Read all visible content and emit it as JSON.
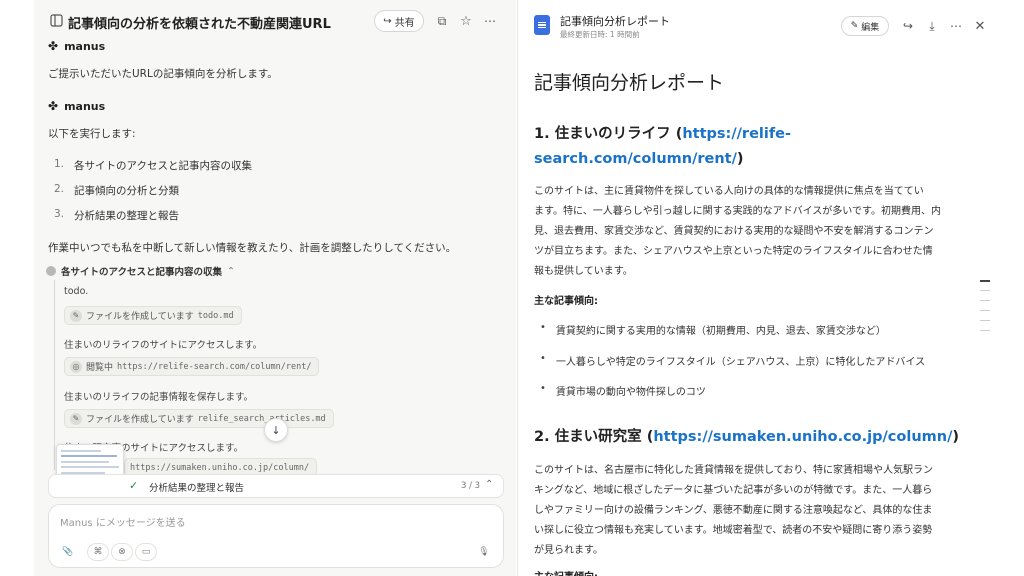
{
  "chat": {
    "title": "記事傾向の分析を依頼された不動産関連URL",
    "share_label": "共有",
    "speaker": "manus",
    "msg1": "ご提示いただいたURLの記事傾向を分析します。",
    "msg2": "以下を実行します:",
    "steps": [
      {
        "num": "1.",
        "text": "各サイトのアクセスと記事内容の収集"
      },
      {
        "num": "2.",
        "text": "記事傾向の分析と分類"
      },
      {
        "num": "3.",
        "text": "分析結果の整理と報告"
      }
    ],
    "msg3": "作業中いつでも私を中断して新しい情報を教えたり、計画を調整したりしてください。",
    "task_title": "各サイトのアクセスと記事内容の収集",
    "logs": [
      "todo.",
      "住まいのリライフのサイトにアクセスします。",
      "住まいのリライフの記事情報を保存します。",
      "住まい研究室のサイトにアクセスします。"
    ],
    "chips": [
      {
        "action": "ファイルを作成しています",
        "detail": "todo.md"
      },
      {
        "action": "閲覧中",
        "detail": "https://relife-search.com/column/rent/"
      },
      {
        "action": "ファイルを作成しています",
        "detail": "relife_search_articles.md"
      },
      {
        "action": "",
        "detail": "https://sumaken.uniho.co.jp/column/"
      }
    ],
    "progress": {
      "label": "分析結果の整理と報告",
      "count": "3 / 3"
    },
    "composer_placeholder": "Manus にメッセージを送る"
  },
  "doc": {
    "header_title": "記事傾向分析レポート",
    "updated": "最終更新日時: 1 時間前",
    "edit_label": "編集",
    "title": "記事傾向分析レポート",
    "s1": {
      "heading_prefix": "1. 住まいのリライフ (",
      "link1": "https://relife-",
      "link2": "search.com/column/rent/",
      "heading_suffix": ")",
      "lines": [
        "このサイトは、主に賃貸物件を探している人向けの具体的な情報提供に焦点を当ててい",
        "ます。特に、一人暮らしや引っ越しに関する実践的なアドバイスが多いです。初期費用、内",
        "見、退去費用、家賃交渉など、賃貸契約における実用的な疑問や不安を解消するコンテン",
        "ツが目立ちます。また、シェアハウスや上京といった特定のライフスタイルに合わせた情",
        "報も提供しています。"
      ],
      "sub": "主な記事傾向:",
      "bullets": [
        "賃貸契約に関する実用的な情報（初期費用、内見、退去、家賃交渉など）",
        "一人暮らしや特定のライフスタイル（シェアハウス、上京）に特化したアドバイス",
        "賃貸市場の動向や物件探しのコツ"
      ]
    },
    "s2": {
      "heading_prefix": "2. 住まい研究室 (",
      "link": "https://sumaken.uniho.co.jp/column/",
      "heading_suffix": ")",
      "lines": [
        "このサイトは、名古屋市に特化した賃貸情報を提供しており、特に家賃相場や人気駅ラン",
        "キングなど、地域に根ざしたデータに基づいた記事が多いのが特徴です。また、一人暮ら",
        "しやファミリー向けの設備ランキング、悪徳不動産に関する注意喚起など、具体的な住ま",
        "い探しに役立つ情報も充実しています。地域密着型で、読者の不安や疑問に寄り添う姿勢",
        "が見られます。"
      ],
      "sub": "主な記事傾向:"
    }
  }
}
